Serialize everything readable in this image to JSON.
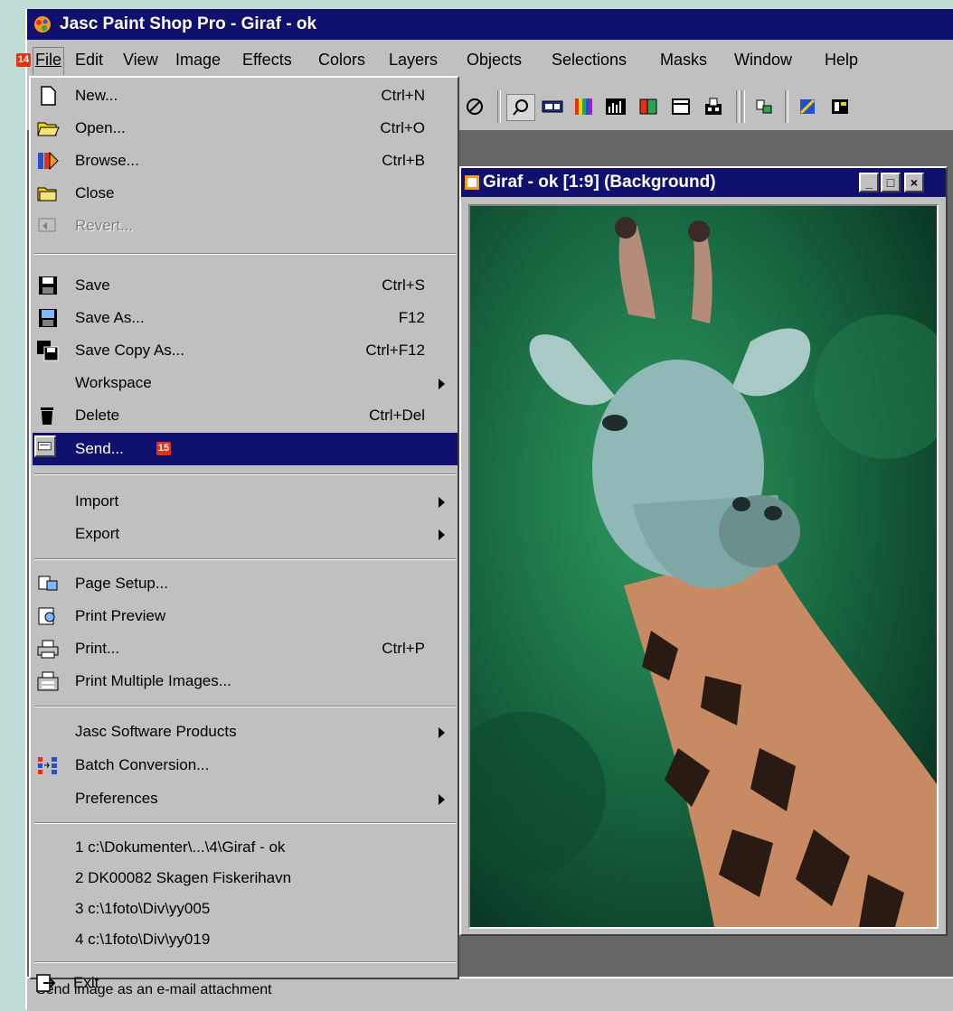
{
  "app_title": "Jasc Paint Shop Pro - Giraf - ok",
  "menubar": {
    "badge": "14",
    "items": [
      "File",
      "Edit",
      "View",
      "Image",
      "Effects",
      "Colors",
      "Layers",
      "Objects",
      "Selections",
      "Masks",
      "Window",
      "Help"
    ]
  },
  "image_window": {
    "title": "Giraf - ok [1:9] (Background)",
    "minimize": "_",
    "maximize": "□",
    "close": "×"
  },
  "file_menu": {
    "new": {
      "label": "New...",
      "shortcut": "Ctrl+N"
    },
    "open": {
      "label": "Open...",
      "shortcut": "Ctrl+O"
    },
    "browse": {
      "label": "Browse...",
      "shortcut": "Ctrl+B"
    },
    "close": {
      "label": "Close"
    },
    "revert": {
      "label": "Revert..."
    },
    "save": {
      "label": "Save",
      "shortcut": "Ctrl+S"
    },
    "save_as": {
      "label": "Save As...",
      "shortcut": "F12"
    },
    "save_copy_as": {
      "label": "Save Copy As...",
      "shortcut": "Ctrl+F12"
    },
    "workspace": {
      "label": "Workspace"
    },
    "delete": {
      "label": "Delete",
      "shortcut": "Ctrl+Del"
    },
    "send": {
      "label": "Send...",
      "badge": "15"
    },
    "import": {
      "label": "Import"
    },
    "export": {
      "label": "Export"
    },
    "page_setup": {
      "label": "Page Setup..."
    },
    "print_preview": {
      "label": "Print Preview"
    },
    "print": {
      "label": "Print...",
      "shortcut": "Ctrl+P"
    },
    "print_multiple": {
      "label": "Print Multiple Images..."
    },
    "jasc_products": {
      "label": "Jasc Software Products"
    },
    "batch_conversion": {
      "label": "Batch Conversion..."
    },
    "preferences": {
      "label": "Preferences"
    },
    "recent": [
      "1 c:\\Dokumenter\\...\\4\\Giraf - ok",
      "2 DK00082 Skagen Fiskerihavn",
      "3 c:\\1foto\\Div\\yy005",
      "4 c:\\1foto\\Div\\yy019"
    ],
    "exit": {
      "label": "Exit"
    }
  },
  "status_text": "Send image as an e-mail attachment",
  "colors": {
    "titlebar": "#10106e",
    "face": "#c0c0c0",
    "highlight": "#10106e",
    "badge": "#e53012",
    "workspace": "#666666"
  },
  "toolbar_icons": [
    "navigation-icon",
    "zoom-icon",
    "overview-icon",
    "color-palette-icon",
    "histogram-icon",
    "channels-icon",
    "window-icon",
    "layers-icon",
    "stamp-icon",
    "magic-wand-icon",
    "layer-palette-icon"
  ]
}
